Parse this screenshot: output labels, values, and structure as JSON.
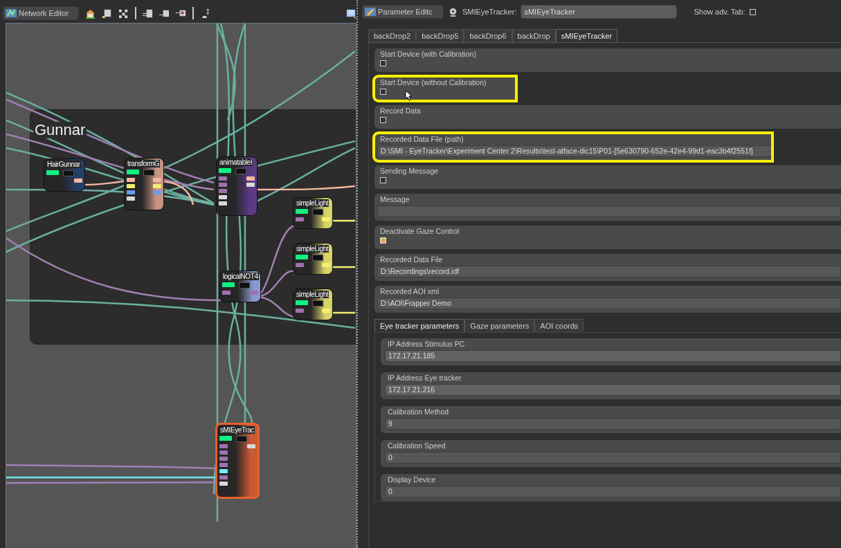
{
  "network_editor": {
    "title": "Network Editor",
    "group": {
      "title": "Gunnar"
    },
    "nodes": [
      {
        "title": "HairGunnar",
        "color": "#24406a",
        "selected": false,
        "outputs": [
          {
            "color": "#f4b8a0"
          }
        ]
      },
      {
        "title": "transformG",
        "color": "#c89484",
        "selected": false,
        "inputs": [
          {
            "color": "#f4b8a0"
          },
          {
            "color": "#f0f070"
          },
          {
            "color": "#6a9cf0"
          },
          {
            "color": "#d8d8d8"
          }
        ],
        "outputs": [
          {
            "color": "#f4b8a0"
          },
          {
            "color": "#f0f070"
          },
          {
            "color": "#6a9cf0"
          }
        ]
      },
      {
        "title": "animatableI",
        "color": "#5c3a86",
        "selected": false,
        "inputs": [
          {
            "color": "#a070b0"
          },
          {
            "color": "#a070b0"
          },
          {
            "color": "#a070b0"
          },
          {
            "color": "#d8d8d8"
          },
          {
            "color": "#d8d8d8"
          }
        ],
        "outputs": [
          {
            "color": "#f4b8a0"
          },
          {
            "color": "#d8d8d8"
          }
        ]
      },
      {
        "title": "simpleLight",
        "color": "#d8d468",
        "selected": false,
        "inputs": [
          {
            "color": "#a070b0"
          }
        ],
        "outputs": [
          {
            "color": "#f6f070"
          }
        ]
      },
      {
        "title": "simpleLight",
        "color": "#d8d468",
        "selected": false,
        "inputs": [
          {
            "color": "#a070b0"
          }
        ],
        "outputs": [
          {
            "color": "#f6f070"
          }
        ]
      },
      {
        "title": "logicalNOT4",
        "color": "#8a9ad0",
        "selected": false,
        "inputs": [
          {
            "color": "#a070b0"
          }
        ],
        "outputs": [
          {
            "color": "#a070b0"
          }
        ]
      },
      {
        "title": "simpleLight",
        "color": "#d8d468",
        "selected": false,
        "inputs": [
          {
            "color": "#a070b0"
          }
        ],
        "outputs": [
          {
            "color": "#f6f070"
          }
        ]
      },
      {
        "title": "sMIEyeTrac",
        "color": "#c85a34",
        "selected": true,
        "inputs": [
          {
            "color": "#a070b0"
          },
          {
            "color": "#a070b0"
          },
          {
            "color": "#a070b0"
          },
          {
            "color": "#a070b0"
          },
          {
            "color": "#70f0f0"
          },
          {
            "color": "#a070b0"
          },
          {
            "color": "#d8d8d8"
          }
        ],
        "outputs": [
          {
            "color": "#d8d8d8"
          }
        ]
      }
    ]
  },
  "parameter_editor": {
    "title": "Parameter Editc",
    "node_label": "SMIEyeTracker:",
    "node_name": "sMIEyeTracker",
    "show_adv_tab": {
      "label": "Show adv. Tab:",
      "checked": false
    },
    "tabs": [
      {
        "label": "backDrop2",
        "selected": false
      },
      {
        "label": "backDrop5",
        "selected": false
      },
      {
        "label": "backDrop6",
        "selected": false
      },
      {
        "label": "backDrop",
        "selected": false
      },
      {
        "label": "sMIEyeTracker",
        "selected": true
      }
    ],
    "parameters": [
      {
        "kind": "checkbox",
        "label": "Start Device (with Calibration)",
        "checked": false,
        "highlighted": false
      },
      {
        "kind": "checkbox",
        "label": "Start Device (without Calibration)",
        "checked": false,
        "highlighted": true
      },
      {
        "kind": "checkbox",
        "label": "Record Data",
        "checked": false,
        "highlighted": false
      },
      {
        "kind": "text",
        "label": "Recorded Data File (path)",
        "value": "D:\\SMI - EyeTracker\\Experiment Center 2\\Results\\test-atface-dic15\\P01-[5e630790-652e-42e4-99d1-eac3b4f2551f]",
        "highlighted": true
      },
      {
        "kind": "checkbox",
        "label": "Sending Message",
        "checked": false,
        "highlighted": false
      },
      {
        "kind": "text",
        "label": "Message",
        "highlighted": false
      },
      {
        "kind": "checkbox",
        "label": "Deactivate Gaze Control",
        "checked": true,
        "highlighted": false
      },
      {
        "kind": "text",
        "label": "Recorded Data File",
        "value": "D:\\Recordings\\record.idf",
        "highlighted": false
      },
      {
        "kind": "text",
        "label": "Recorded AOI xml",
        "value": "D:\\AOI\\Frapper Demo",
        "highlighted": false
      }
    ],
    "sub_tabs": [
      {
        "label": "Eye tracker parameters",
        "selected": true
      },
      {
        "label": "Gaze parameters",
        "selected": false
      },
      {
        "label": "AOI coords",
        "selected": false
      }
    ],
    "sub_parameters": [
      {
        "label": "IP Address Stimulus PC",
        "value": "172.17.21.185"
      },
      {
        "label": "IP Address Eye tracker",
        "value": "172.17.21.216"
      },
      {
        "label": "Calibration Method",
        "value": "9"
      },
      {
        "label": "Calibration Speed",
        "value": "0"
      },
      {
        "label": "Display Device",
        "value": "0"
      }
    ]
  }
}
